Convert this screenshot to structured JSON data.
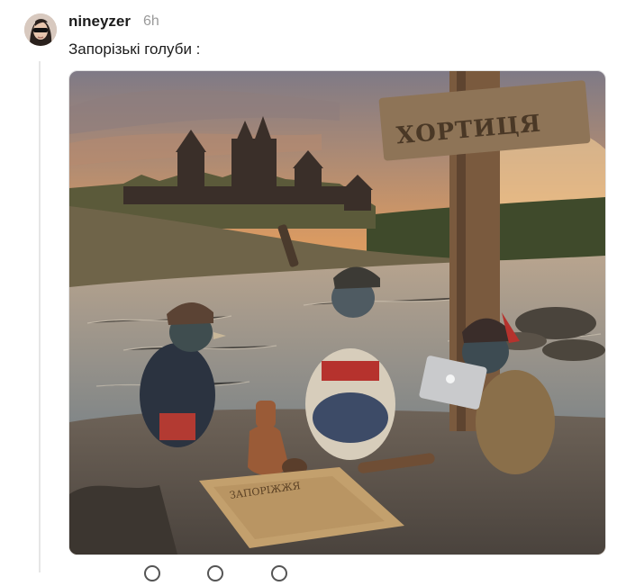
{
  "post": {
    "username": "nineyzer",
    "timestamp": "6h",
    "text": "Запорізькі голуби :",
    "image": {
      "sign_text": "ХОРТИЦЯ",
      "map_text": "ЗАПОРІЖЖЯ"
    }
  },
  "icons": {
    "avatar": "user-avatar",
    "actions": [
      "like-icon",
      "reply-icon",
      "repost-icon"
    ]
  },
  "colors": {
    "username": "#1c1c1c",
    "timestamp": "#9a9a9a",
    "thread_line": "#e6e6e6"
  }
}
